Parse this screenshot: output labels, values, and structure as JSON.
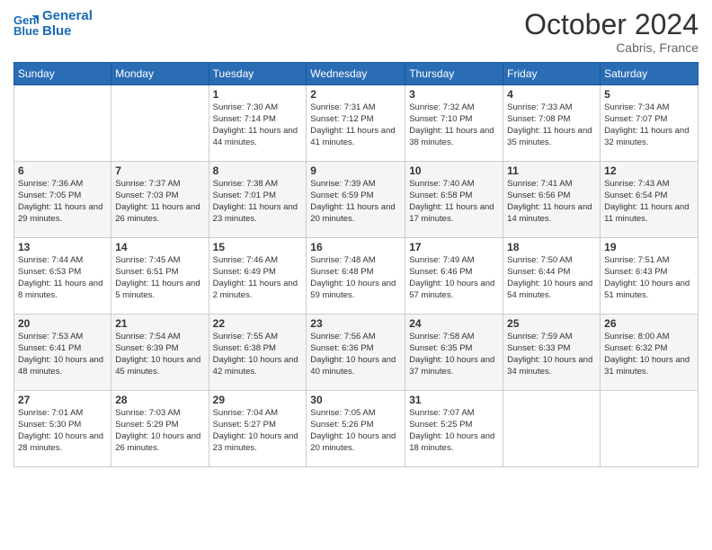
{
  "header": {
    "logo_line1": "General",
    "logo_line2": "Blue",
    "month": "October 2024",
    "location": "Cabris, France"
  },
  "days_of_week": [
    "Sunday",
    "Monday",
    "Tuesday",
    "Wednesday",
    "Thursday",
    "Friday",
    "Saturday"
  ],
  "weeks": [
    [
      {
        "day": "",
        "info": ""
      },
      {
        "day": "",
        "info": ""
      },
      {
        "day": "1",
        "info": "Sunrise: 7:30 AM\nSunset: 7:14 PM\nDaylight: 11 hours and 44 minutes."
      },
      {
        "day": "2",
        "info": "Sunrise: 7:31 AM\nSunset: 7:12 PM\nDaylight: 11 hours and 41 minutes."
      },
      {
        "day": "3",
        "info": "Sunrise: 7:32 AM\nSunset: 7:10 PM\nDaylight: 11 hours and 38 minutes."
      },
      {
        "day": "4",
        "info": "Sunrise: 7:33 AM\nSunset: 7:08 PM\nDaylight: 11 hours and 35 minutes."
      },
      {
        "day": "5",
        "info": "Sunrise: 7:34 AM\nSunset: 7:07 PM\nDaylight: 11 hours and 32 minutes."
      }
    ],
    [
      {
        "day": "6",
        "info": "Sunrise: 7:36 AM\nSunset: 7:05 PM\nDaylight: 11 hours and 29 minutes."
      },
      {
        "day": "7",
        "info": "Sunrise: 7:37 AM\nSunset: 7:03 PM\nDaylight: 11 hours and 26 minutes."
      },
      {
        "day": "8",
        "info": "Sunrise: 7:38 AM\nSunset: 7:01 PM\nDaylight: 11 hours and 23 minutes."
      },
      {
        "day": "9",
        "info": "Sunrise: 7:39 AM\nSunset: 6:59 PM\nDaylight: 11 hours and 20 minutes."
      },
      {
        "day": "10",
        "info": "Sunrise: 7:40 AM\nSunset: 6:58 PM\nDaylight: 11 hours and 17 minutes."
      },
      {
        "day": "11",
        "info": "Sunrise: 7:41 AM\nSunset: 6:56 PM\nDaylight: 11 hours and 14 minutes."
      },
      {
        "day": "12",
        "info": "Sunrise: 7:43 AM\nSunset: 6:54 PM\nDaylight: 11 hours and 11 minutes."
      }
    ],
    [
      {
        "day": "13",
        "info": "Sunrise: 7:44 AM\nSunset: 6:53 PM\nDaylight: 11 hours and 8 minutes."
      },
      {
        "day": "14",
        "info": "Sunrise: 7:45 AM\nSunset: 6:51 PM\nDaylight: 11 hours and 5 minutes."
      },
      {
        "day": "15",
        "info": "Sunrise: 7:46 AM\nSunset: 6:49 PM\nDaylight: 11 hours and 2 minutes."
      },
      {
        "day": "16",
        "info": "Sunrise: 7:48 AM\nSunset: 6:48 PM\nDaylight: 10 hours and 59 minutes."
      },
      {
        "day": "17",
        "info": "Sunrise: 7:49 AM\nSunset: 6:46 PM\nDaylight: 10 hours and 57 minutes."
      },
      {
        "day": "18",
        "info": "Sunrise: 7:50 AM\nSunset: 6:44 PM\nDaylight: 10 hours and 54 minutes."
      },
      {
        "day": "19",
        "info": "Sunrise: 7:51 AM\nSunset: 6:43 PM\nDaylight: 10 hours and 51 minutes."
      }
    ],
    [
      {
        "day": "20",
        "info": "Sunrise: 7:53 AM\nSunset: 6:41 PM\nDaylight: 10 hours and 48 minutes."
      },
      {
        "day": "21",
        "info": "Sunrise: 7:54 AM\nSunset: 6:39 PM\nDaylight: 10 hours and 45 minutes."
      },
      {
        "day": "22",
        "info": "Sunrise: 7:55 AM\nSunset: 6:38 PM\nDaylight: 10 hours and 42 minutes."
      },
      {
        "day": "23",
        "info": "Sunrise: 7:56 AM\nSunset: 6:36 PM\nDaylight: 10 hours and 40 minutes."
      },
      {
        "day": "24",
        "info": "Sunrise: 7:58 AM\nSunset: 6:35 PM\nDaylight: 10 hours and 37 minutes."
      },
      {
        "day": "25",
        "info": "Sunrise: 7:59 AM\nSunset: 6:33 PM\nDaylight: 10 hours and 34 minutes."
      },
      {
        "day": "26",
        "info": "Sunrise: 8:00 AM\nSunset: 6:32 PM\nDaylight: 10 hours and 31 minutes."
      }
    ],
    [
      {
        "day": "27",
        "info": "Sunrise: 7:01 AM\nSunset: 5:30 PM\nDaylight: 10 hours and 28 minutes."
      },
      {
        "day": "28",
        "info": "Sunrise: 7:03 AM\nSunset: 5:29 PM\nDaylight: 10 hours and 26 minutes."
      },
      {
        "day": "29",
        "info": "Sunrise: 7:04 AM\nSunset: 5:27 PM\nDaylight: 10 hours and 23 minutes."
      },
      {
        "day": "30",
        "info": "Sunrise: 7:05 AM\nSunset: 5:26 PM\nDaylight: 10 hours and 20 minutes."
      },
      {
        "day": "31",
        "info": "Sunrise: 7:07 AM\nSunset: 5:25 PM\nDaylight: 10 hours and 18 minutes."
      },
      {
        "day": "",
        "info": ""
      },
      {
        "day": "",
        "info": ""
      }
    ]
  ]
}
